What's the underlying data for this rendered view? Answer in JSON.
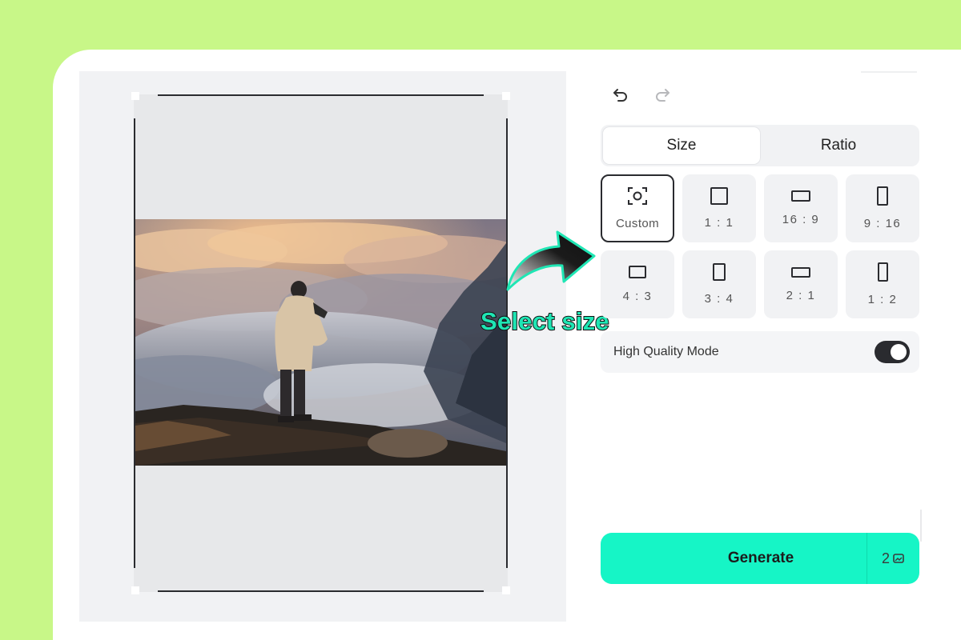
{
  "toolbar": {
    "undo_icon": "undo-icon",
    "redo_icon": "redo-icon"
  },
  "tabs": [
    {
      "label": "Size",
      "active": true
    },
    {
      "label": "Ratio",
      "active": false
    }
  ],
  "ratios": [
    {
      "label": "Custom",
      "icon": "custom-size-icon",
      "selected": true
    },
    {
      "label": "1 : 1",
      "selected": false
    },
    {
      "label": "16 : 9",
      "selected": false
    },
    {
      "label": "9 : 16",
      "selected": false
    },
    {
      "label": "4 : 3",
      "selected": false
    },
    {
      "label": "3 : 4",
      "selected": false
    },
    {
      "label": "2 : 1",
      "selected": false
    },
    {
      "label": "1 : 2",
      "selected": false
    }
  ],
  "high_quality": {
    "label": "High Quality Mode",
    "enabled": true
  },
  "generate": {
    "label": "Generate",
    "credits": "2"
  },
  "annotation": {
    "text": "Select size"
  },
  "colors": {
    "background": "#c8f788",
    "accent": "#16f5c6",
    "dark": "#2a2b2f"
  }
}
